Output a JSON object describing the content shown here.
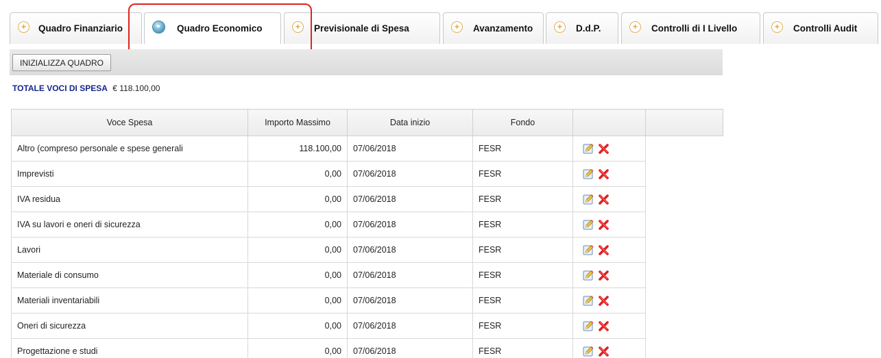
{
  "tabs": [
    {
      "label": "Quadro Finanziario",
      "icon": "plus-icon",
      "active": false
    },
    {
      "label": "Quadro Economico",
      "icon": "collapse-icon",
      "active": true
    },
    {
      "label": "Previsionale di Spesa",
      "icon": "plus-icon",
      "active": false
    },
    {
      "label": "Avanzamento",
      "icon": "plus-icon",
      "active": false
    },
    {
      "label": "D.d.P.",
      "icon": "plus-icon",
      "active": false
    },
    {
      "label": "Controlli di I Livello",
      "icon": "plus-icon",
      "active": false
    },
    {
      "label": "Controlli Audit",
      "icon": "plus-icon",
      "active": false
    }
  ],
  "toolbar": {
    "init_button": "INIZIALIZZA QUADRO"
  },
  "totals": {
    "label": "TOTALE VOCI DI SPESA",
    "value": "€ 118.100,00"
  },
  "table": {
    "headers": [
      "Voce Spesa",
      "Importo Massimo",
      "Data inizio",
      "Fondo",
      "",
      ""
    ],
    "rows": [
      {
        "voce": "Altro (compreso personale e spese generali",
        "importo": "118.100,00",
        "data": "07/06/2018",
        "fondo": "FESR"
      },
      {
        "voce": "Imprevisti",
        "importo": "0,00",
        "data": "07/06/2018",
        "fondo": "FESR"
      },
      {
        "voce": "IVA residua",
        "importo": "0,00",
        "data": "07/06/2018",
        "fondo": "FESR"
      },
      {
        "voce": "IVA su lavori e oneri di sicurezza",
        "importo": "0,00",
        "data": "07/06/2018",
        "fondo": "FESR"
      },
      {
        "voce": "Lavori",
        "importo": "0,00",
        "data": "07/06/2018",
        "fondo": "FESR"
      },
      {
        "voce": "Materiale di consumo",
        "importo": "0,00",
        "data": "07/06/2018",
        "fondo": "FESR"
      },
      {
        "voce": "Materiali inventariabili",
        "importo": "0,00",
        "data": "07/06/2018",
        "fondo": "FESR"
      },
      {
        "voce": "Oneri di sicurezza",
        "importo": "0,00",
        "data": "07/06/2018",
        "fondo": "FESR"
      },
      {
        "voce": "Progettazione e studi",
        "importo": "0,00",
        "data": "07/06/2018",
        "fondo": "FESR"
      }
    ],
    "row_actions": [
      "edit-icon",
      "delete-icon"
    ]
  },
  "colors": {
    "accent_blue": "#15268a",
    "highlight_red": "#e0231f",
    "delete_red": "#e02020",
    "tab_plus_orange": "#e0a53f"
  }
}
